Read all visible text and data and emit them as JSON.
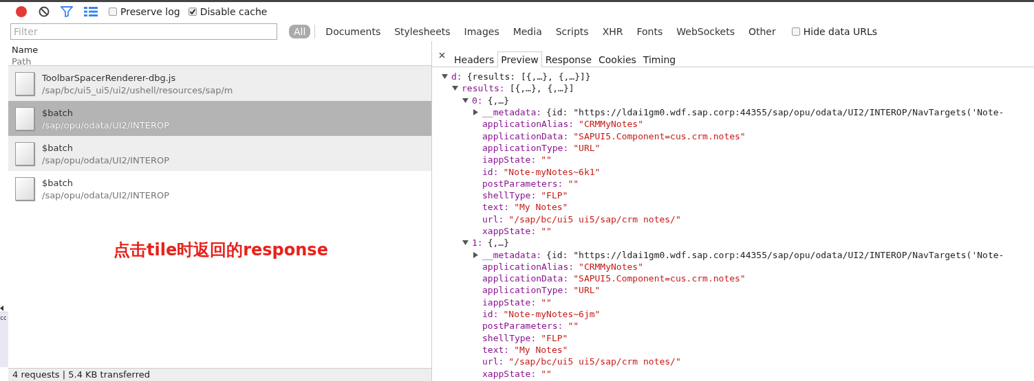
{
  "toolbar": {
    "preserve_log": {
      "label": "Preserve log",
      "checked": false
    },
    "disable_cache": {
      "label": "Disable cache",
      "checked": true
    }
  },
  "filter": {
    "placeholder": "Filter"
  },
  "types": [
    {
      "label": "All",
      "selected": true
    },
    {
      "label": "Documents",
      "selected": false
    },
    {
      "label": "Stylesheets",
      "selected": false
    },
    {
      "label": "Images",
      "selected": false
    },
    {
      "label": "Media",
      "selected": false
    },
    {
      "label": "Scripts",
      "selected": false
    },
    {
      "label": "XHR",
      "selected": false
    },
    {
      "label": "Fonts",
      "selected": false
    },
    {
      "label": "WebSockets",
      "selected": false
    },
    {
      "label": "Other",
      "selected": false
    }
  ],
  "hide_data_urls": {
    "label": "Hide data URLs",
    "checked": false
  },
  "columns": {
    "name": "Name",
    "path": "Path"
  },
  "requests": [
    {
      "name": "ToolbarSpacerRenderer-dbg.js",
      "path": "/sap/bc/ui5_ui5/ui2/ushell/resources/sap/m",
      "selected": false
    },
    {
      "name": "$batch",
      "path": "/sap/opu/odata/UI2/INTEROP",
      "selected": true
    },
    {
      "name": "$batch",
      "path": "/sap/opu/odata/UI2/INTEROP",
      "selected": false
    },
    {
      "name": "$batch",
      "path": "/sap/opu/odata/UI2/INTEROP",
      "selected": false
    }
  ],
  "annotation": "点击tile时返回的response",
  "edge_fragment": "cc",
  "status_bar": "4 requests | 5.4 KB transferred",
  "detail_tabs": [
    {
      "label": "Headers",
      "selected": false
    },
    {
      "label": "Preview",
      "selected": true
    },
    {
      "label": "Response",
      "selected": false
    },
    {
      "label": "Cookies",
      "selected": false
    },
    {
      "label": "Timing",
      "selected": false
    }
  ],
  "preview": [
    {
      "key": "d:",
      "value": "{results: [{,…}, {,…}]}",
      "kind": "object",
      "expanded": true,
      "children": [
        {
          "key": "results:",
          "value": "[{,…}, {,…}]",
          "kind": "object",
          "expanded": true,
          "children": [
            {
              "key": "0:",
              "value": "{,…}",
              "kind": "object",
              "expanded": true,
              "children": [
                {
                  "key": "__metadata:",
                  "value": "{id: \"https://ldai1gm0.wdf.sap.corp:44355/sap/opu/odata/UI2/INTEROP/NavTargets('Note-",
                  "kind": "object",
                  "expanded": false
                },
                {
                  "key": "applicationAlias:",
                  "value": "\"CRMMyNotes\"",
                  "kind": "leaf"
                },
                {
                  "key": "applicationData:",
                  "value": "\"SAPUI5.Component=cus.crm.notes\"",
                  "kind": "leaf"
                },
                {
                  "key": "applicationType:",
                  "value": "\"URL\"",
                  "kind": "leaf"
                },
                {
                  "key": "iappState:",
                  "value": "\"\"",
                  "kind": "leaf"
                },
                {
                  "key": "id:",
                  "value": "\"Note-myNotes~6k1\"",
                  "kind": "leaf"
                },
                {
                  "key": "postParameters:",
                  "value": "\"\"",
                  "kind": "leaf"
                },
                {
                  "key": "shellType:",
                  "value": "\"FLP\"",
                  "kind": "leaf"
                },
                {
                  "key": "text:",
                  "value": "\"My Notes\"",
                  "kind": "leaf"
                },
                {
                  "key": "url:",
                  "value": "\"/sap/bc/ui5 ui5/sap/crm notes/\"",
                  "kind": "leaf"
                },
                {
                  "key": "xappState:",
                  "value": "\"\"",
                  "kind": "leaf"
                }
              ]
            },
            {
              "key": "1:",
              "value": "{,…}",
              "kind": "object",
              "expanded": true,
              "children": [
                {
                  "key": "__metadata:",
                  "value": "{id: \"https://ldai1gm0.wdf.sap.corp:44355/sap/opu/odata/UI2/INTEROP/NavTargets('Note-",
                  "kind": "object",
                  "expanded": false
                },
                {
                  "key": "applicationAlias:",
                  "value": "\"CRMMyNotes\"",
                  "kind": "leaf"
                },
                {
                  "key": "applicationData:",
                  "value": "\"SAPUI5.Component=cus.crm.notes\"",
                  "kind": "leaf"
                },
                {
                  "key": "applicationType:",
                  "value": "\"URL\"",
                  "kind": "leaf"
                },
                {
                  "key": "iappState:",
                  "value": "\"\"",
                  "kind": "leaf"
                },
                {
                  "key": "id:",
                  "value": "\"Note-myNotes~6jm\"",
                  "kind": "leaf"
                },
                {
                  "key": "postParameters:",
                  "value": "\"\"",
                  "kind": "leaf"
                },
                {
                  "key": "shellType:",
                  "value": "\"FLP\"",
                  "kind": "leaf"
                },
                {
                  "key": "text:",
                  "value": "\"My Notes\"",
                  "kind": "leaf"
                },
                {
                  "key": "url:",
                  "value": "\"/sap/bc/ui5 ui5/sap/crm notes/\"",
                  "kind": "leaf"
                },
                {
                  "key": "xappState:",
                  "value": "\"\"",
                  "kind": "leaf"
                }
              ]
            }
          ]
        }
      ]
    }
  ]
}
